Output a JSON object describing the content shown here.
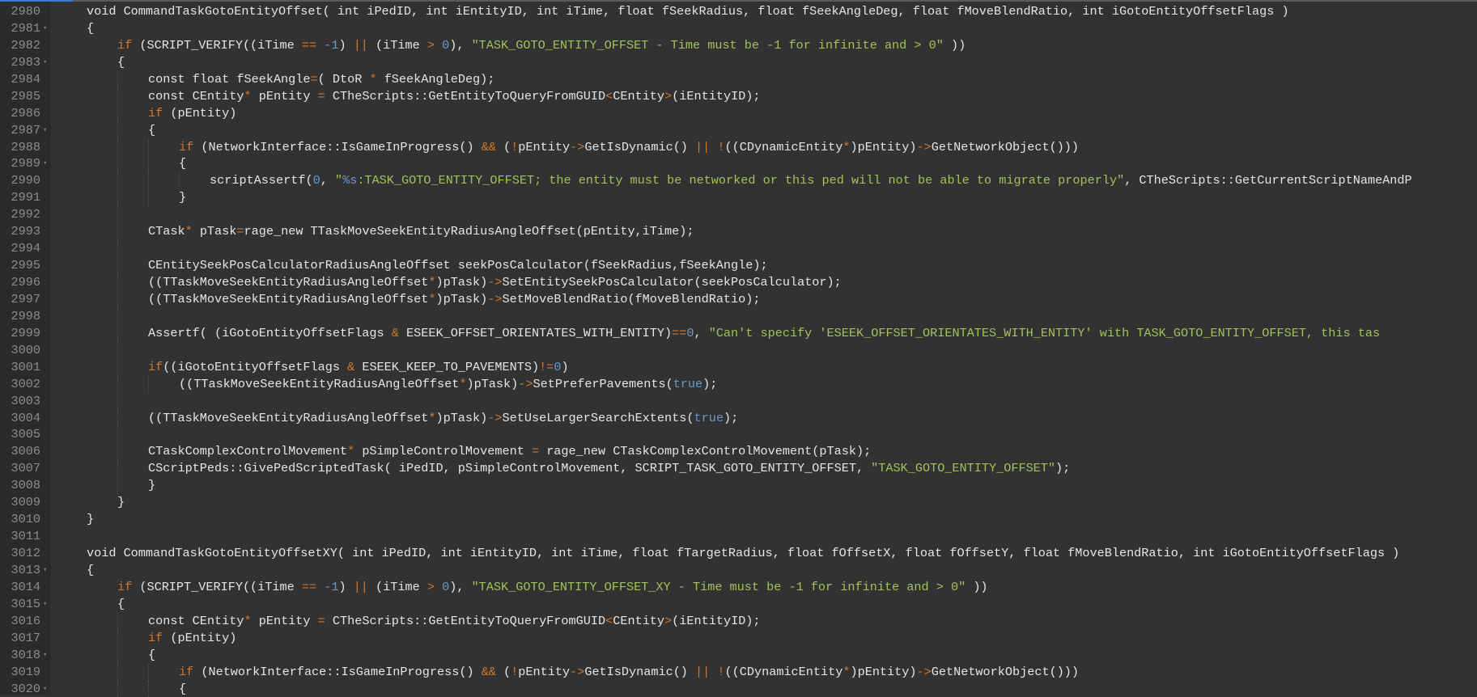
{
  "editor": {
    "colors": {
      "background": "#323232",
      "gutter": "#2b2b2b",
      "keyword": "#d1782f",
      "string": "#a3c25a",
      "number": "#6a9ac8",
      "text": "#e6e6e6"
    },
    "lines": [
      {
        "num": "2980",
        "indent": 1,
        "tokens": [
          [
            "t",
            "void CommandTaskGotoEntityOffset( int iPedID, int iEntityID, int iTime, float fSeekRadius, float fSeekAngleDeg, float fMoveBlendRatio, int iGotoEntityOffsetFlags )"
          ]
        ]
      },
      {
        "num": "2981",
        "indent": 1,
        "fold": true,
        "tokens": [
          [
            "t",
            "{"
          ]
        ]
      },
      {
        "num": "2982",
        "indent": 2,
        "tokens": [
          [
            "k",
            "if"
          ],
          [
            "t",
            " (SCRIPT_VERIFY((iTime "
          ],
          [
            "o",
            "=="
          ],
          [
            "t",
            " "
          ],
          [
            "n",
            "-1"
          ],
          [
            "t",
            ") "
          ],
          [
            "o",
            "||"
          ],
          [
            "t",
            " (iTime "
          ],
          [
            "o",
            ">"
          ],
          [
            "t",
            " "
          ],
          [
            "n",
            "0"
          ],
          [
            "t",
            "), "
          ],
          [
            "s",
            "\"TASK_GOTO_ENTITY_OFFSET - Time must be -1 for infinite and > 0\""
          ],
          [
            "t",
            " ))"
          ]
        ]
      },
      {
        "num": "2983",
        "indent": 2,
        "fold": true,
        "tokens": [
          [
            "t",
            "{"
          ]
        ]
      },
      {
        "num": "2984",
        "indent": 3,
        "tokens": [
          [
            "t",
            "const float fSeekAngle"
          ],
          [
            "o",
            "="
          ],
          [
            "t",
            "( DtoR "
          ],
          [
            "o",
            "*"
          ],
          [
            "t",
            " fSeekAngleDeg);"
          ]
        ]
      },
      {
        "num": "2985",
        "indent": 3,
        "tokens": [
          [
            "t",
            "const CEntity"
          ],
          [
            "o",
            "*"
          ],
          [
            "t",
            " pEntity "
          ],
          [
            "o",
            "="
          ],
          [
            "t",
            " CTheScripts::GetEntityToQueryFromGUID"
          ],
          [
            "o",
            "<"
          ],
          [
            "t",
            "CEntity"
          ],
          [
            "o",
            ">"
          ],
          [
            "t",
            "(iEntityID);"
          ]
        ]
      },
      {
        "num": "2986",
        "indent": 3,
        "tokens": [
          [
            "k",
            "if"
          ],
          [
            "t",
            " (pEntity)"
          ]
        ]
      },
      {
        "num": "2987",
        "indent": 3,
        "fold": true,
        "tokens": [
          [
            "t",
            "{"
          ]
        ]
      },
      {
        "num": "2988",
        "indent": 4,
        "tokens": [
          [
            "k",
            "if"
          ],
          [
            "t",
            " (NetworkInterface::IsGameInProgress() "
          ],
          [
            "o",
            "&&"
          ],
          [
            "t",
            " ("
          ],
          [
            "o",
            "!"
          ],
          [
            "t",
            "pEntity"
          ],
          [
            "o",
            "->"
          ],
          [
            "t",
            "GetIsDynamic() "
          ],
          [
            "o",
            "||"
          ],
          [
            "t",
            " "
          ],
          [
            "o",
            "!"
          ],
          [
            "t",
            "((CDynamicEntity"
          ],
          [
            "o",
            "*"
          ],
          [
            "t",
            ")pEntity)"
          ],
          [
            "o",
            "->"
          ],
          [
            "t",
            "GetNetworkObject()))"
          ]
        ]
      },
      {
        "num": "2989",
        "indent": 4,
        "fold": true,
        "tokens": [
          [
            "t",
            "{"
          ]
        ]
      },
      {
        "num": "2990",
        "indent": 5,
        "tokens": [
          [
            "t",
            "scriptAssertf("
          ],
          [
            "n",
            "0"
          ],
          [
            "t",
            ", "
          ],
          [
            "s",
            "\""
          ],
          [
            "n",
            "%s"
          ],
          [
            "s",
            ":TASK_GOTO_ENTITY_OFFSET; the entity must be networked or this ped will not be able to migrate properly\""
          ],
          [
            "t",
            ", CTheScripts::GetCurrentScriptNameAndP"
          ]
        ]
      },
      {
        "num": "2991",
        "indent": 4,
        "tokens": [
          [
            "t",
            "}"
          ]
        ]
      },
      {
        "num": "2992",
        "indent": 3,
        "tokens": []
      },
      {
        "num": "2993",
        "indent": 3,
        "tokens": [
          [
            "t",
            "CTask"
          ],
          [
            "o",
            "*"
          ],
          [
            "t",
            " pTask"
          ],
          [
            "o",
            "="
          ],
          [
            "t",
            "rage_new TTaskMoveSeekEntityRadiusAngleOffset(pEntity,iTime);"
          ]
        ]
      },
      {
        "num": "2994",
        "indent": 3,
        "tokens": []
      },
      {
        "num": "2995",
        "indent": 3,
        "tokens": [
          [
            "t",
            "CEntitySeekPosCalculatorRadiusAngleOffset seekPosCalculator(fSeekRadius,fSeekAngle);"
          ]
        ]
      },
      {
        "num": "2996",
        "indent": 3,
        "tokens": [
          [
            "t",
            "((TTaskMoveSeekEntityRadiusAngleOffset"
          ],
          [
            "o",
            "*"
          ],
          [
            "t",
            ")pTask)"
          ],
          [
            "o",
            "->"
          ],
          [
            "t",
            "SetEntitySeekPosCalculator(seekPosCalculator);"
          ]
        ]
      },
      {
        "num": "2997",
        "indent": 3,
        "tokens": [
          [
            "t",
            "((TTaskMoveSeekEntityRadiusAngleOffset"
          ],
          [
            "o",
            "*"
          ],
          [
            "t",
            ")pTask)"
          ],
          [
            "o",
            "->"
          ],
          [
            "t",
            "SetMoveBlendRatio(fMoveBlendRatio);"
          ]
        ]
      },
      {
        "num": "2998",
        "indent": 3,
        "tokens": []
      },
      {
        "num": "2999",
        "indent": 3,
        "tokens": [
          [
            "t",
            "Assertf( (iGotoEntityOffsetFlags "
          ],
          [
            "o",
            "&"
          ],
          [
            "t",
            " ESEEK_OFFSET_ORIENTATES_WITH_ENTITY)"
          ],
          [
            "o",
            "=="
          ],
          [
            "n",
            "0"
          ],
          [
            "t",
            ", "
          ],
          [
            "s",
            "\"Can't specify 'ESEEK_OFFSET_ORIENTATES_WITH_ENTITY' with TASK_GOTO_ENTITY_OFFSET, this tas"
          ]
        ]
      },
      {
        "num": "3000",
        "indent": 3,
        "tokens": []
      },
      {
        "num": "3001",
        "indent": 3,
        "tokens": [
          [
            "k",
            "if"
          ],
          [
            "t",
            "((iGotoEntityOffsetFlags "
          ],
          [
            "o",
            "&"
          ],
          [
            "t",
            " ESEEK_KEEP_TO_PAVEMENTS)"
          ],
          [
            "o",
            "!="
          ],
          [
            "n",
            "0"
          ],
          [
            "t",
            ")"
          ]
        ]
      },
      {
        "num": "3002",
        "indent": 4,
        "tokens": [
          [
            "t",
            "((TTaskMoveSeekEntityRadiusAngleOffset"
          ],
          [
            "o",
            "*"
          ],
          [
            "t",
            ")pTask)"
          ],
          [
            "o",
            "->"
          ],
          [
            "t",
            "SetPreferPavements("
          ],
          [
            "n",
            "true"
          ],
          [
            "t",
            ");"
          ]
        ]
      },
      {
        "num": "3003",
        "indent": 3,
        "tokens": []
      },
      {
        "num": "3004",
        "indent": 3,
        "tokens": [
          [
            "t",
            "((TTaskMoveSeekEntityRadiusAngleOffset"
          ],
          [
            "o",
            "*"
          ],
          [
            "t",
            ")pTask)"
          ],
          [
            "o",
            "->"
          ],
          [
            "t",
            "SetUseLargerSearchExtents("
          ],
          [
            "n",
            "true"
          ],
          [
            "t",
            ");"
          ]
        ]
      },
      {
        "num": "3005",
        "indent": 3,
        "tokens": []
      },
      {
        "num": "3006",
        "indent": 3,
        "tokens": [
          [
            "t",
            "CTaskComplexControlMovement"
          ],
          [
            "o",
            "*"
          ],
          [
            "t",
            " pSimpleControlMovement "
          ],
          [
            "o",
            "="
          ],
          [
            "t",
            " rage_new CTaskComplexControlMovement(pTask);"
          ]
        ]
      },
      {
        "num": "3007",
        "indent": 3,
        "tokens": [
          [
            "t",
            "CScriptPeds::GivePedScriptedTask( iPedID, pSimpleControlMovement, SCRIPT_TASK_GOTO_ENTITY_OFFSET, "
          ],
          [
            "s",
            "\"TASK_GOTO_ENTITY_OFFSET\""
          ],
          [
            "t",
            ");"
          ]
        ]
      },
      {
        "num": "3008",
        "indent": 3,
        "tokens": [
          [
            "t",
            "}"
          ]
        ]
      },
      {
        "num": "3009",
        "indent": 2,
        "tokens": [
          [
            "t",
            "}"
          ]
        ]
      },
      {
        "num": "3010",
        "indent": 1,
        "tokens": [
          [
            "t",
            "}"
          ]
        ]
      },
      {
        "num": "3011",
        "indent": 1,
        "tokens": []
      },
      {
        "num": "3012",
        "indent": 1,
        "tokens": [
          [
            "t",
            "void CommandTaskGotoEntityOffsetXY( int iPedID, int iEntityID, int iTime, float fTargetRadius, float fOffsetX, float fOffsetY, float fMoveBlendRatio, int iGotoEntityOffsetFlags )"
          ]
        ]
      },
      {
        "num": "3013",
        "indent": 1,
        "fold": true,
        "tokens": [
          [
            "t",
            "{"
          ]
        ]
      },
      {
        "num": "3014",
        "indent": 2,
        "tokens": [
          [
            "k",
            "if"
          ],
          [
            "t",
            " (SCRIPT_VERIFY((iTime "
          ],
          [
            "o",
            "=="
          ],
          [
            "t",
            " "
          ],
          [
            "n",
            "-1"
          ],
          [
            "t",
            ") "
          ],
          [
            "o",
            "||"
          ],
          [
            "t",
            " (iTime "
          ],
          [
            "o",
            ">"
          ],
          [
            "t",
            " "
          ],
          [
            "n",
            "0"
          ],
          [
            "t",
            "), "
          ],
          [
            "s",
            "\"TASK_GOTO_ENTITY_OFFSET_XY - Time must be -1 for infinite and > 0\""
          ],
          [
            "t",
            " ))"
          ]
        ]
      },
      {
        "num": "3015",
        "indent": 2,
        "fold": true,
        "tokens": [
          [
            "t",
            "{"
          ]
        ]
      },
      {
        "num": "3016",
        "indent": 3,
        "tokens": [
          [
            "t",
            "const CEntity"
          ],
          [
            "o",
            "*"
          ],
          [
            "t",
            " pEntity "
          ],
          [
            "o",
            "="
          ],
          [
            "t",
            " CTheScripts::GetEntityToQueryFromGUID"
          ],
          [
            "o",
            "<"
          ],
          [
            "t",
            "CEntity"
          ],
          [
            "o",
            ">"
          ],
          [
            "t",
            "(iEntityID);"
          ]
        ]
      },
      {
        "num": "3017",
        "indent": 3,
        "tokens": [
          [
            "k",
            "if"
          ],
          [
            "t",
            " (pEntity)"
          ]
        ]
      },
      {
        "num": "3018",
        "indent": 3,
        "fold": true,
        "tokens": [
          [
            "t",
            "{"
          ]
        ]
      },
      {
        "num": "3019",
        "indent": 4,
        "tokens": [
          [
            "k",
            "if"
          ],
          [
            "t",
            " (NetworkInterface::IsGameInProgress() "
          ],
          [
            "o",
            "&&"
          ],
          [
            "t",
            " ("
          ],
          [
            "o",
            "!"
          ],
          [
            "t",
            "pEntity"
          ],
          [
            "o",
            "->"
          ],
          [
            "t",
            "GetIsDynamic() "
          ],
          [
            "o",
            "||"
          ],
          [
            "t",
            " "
          ],
          [
            "o",
            "!"
          ],
          [
            "t",
            "((CDynamicEntity"
          ],
          [
            "o",
            "*"
          ],
          [
            "t",
            ")pEntity)"
          ],
          [
            "o",
            "->"
          ],
          [
            "t",
            "GetNetworkObject()))"
          ]
        ]
      },
      {
        "num": "3020",
        "indent": 4,
        "fold": true,
        "tokens": [
          [
            "t",
            "{"
          ]
        ]
      }
    ]
  }
}
